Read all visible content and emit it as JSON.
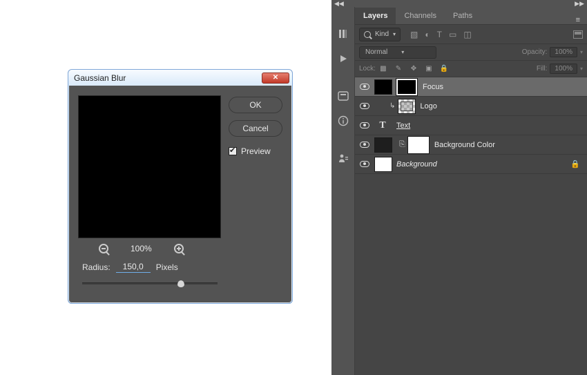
{
  "dialog": {
    "title": "Gaussian Blur",
    "ok": "OK",
    "cancel": "Cancel",
    "preview_label": "Preview",
    "preview_checked": true,
    "zoom": "100%",
    "radius_label": "Radius:",
    "radius_value": "150,0",
    "radius_unit": "Pixels"
  },
  "panel": {
    "tabs": {
      "layers": "Layers",
      "channels": "Channels",
      "paths": "Paths"
    },
    "filter": {
      "kind_label": "Kind"
    },
    "blend": {
      "mode": "Normal",
      "opacity_label": "Opacity:",
      "opacity_value": "100%"
    },
    "lock": {
      "label": "Lock:",
      "fill_label": "Fill:",
      "fill_value": "100%"
    },
    "layers": [
      {
        "name": "Focus"
      },
      {
        "name": "Logo"
      },
      {
        "name": "Text"
      },
      {
        "name": "Background Color"
      },
      {
        "name": "Background"
      }
    ]
  }
}
